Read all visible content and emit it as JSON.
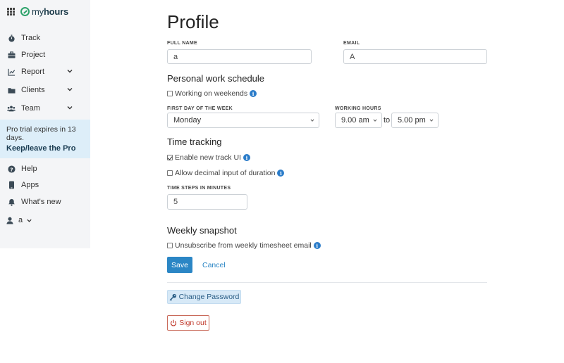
{
  "brand": {
    "name_prefix": "my",
    "name_suffix": "hours"
  },
  "sidebar": {
    "items": [
      {
        "label": "Track",
        "icon": "stopwatch-icon"
      },
      {
        "label": "Project",
        "icon": "briefcase-icon"
      },
      {
        "label": "Report",
        "icon": "chart-icon",
        "expandable": true
      },
      {
        "label": "Clients",
        "icon": "folder-icon",
        "expandable": true
      },
      {
        "label": "Team",
        "icon": "team-icon",
        "expandable": true
      }
    ],
    "trial_text": "Pro trial expires in 13 days.",
    "trial_link": "Keep/leave the Pro",
    "bottom_items": [
      {
        "label": "Help",
        "icon": "help-icon"
      },
      {
        "label": "Apps",
        "icon": "phone-icon"
      },
      {
        "label": "What's new",
        "icon": "bell-icon"
      }
    ],
    "user_label": "a"
  },
  "profile": {
    "title": "Profile",
    "full_name_label": "FULL NAME",
    "full_name_value": "a",
    "email_label": "EMAIL",
    "email_value": "A",
    "schedule_title": "Personal work schedule",
    "weekends_label": "Working on weekends",
    "weekends_checked": false,
    "first_day_label": "FIRST DAY OF THE WEEK",
    "first_day_value": "Monday",
    "working_hours_label": "WORKING HOURS",
    "hours_from": "9.00 am",
    "hours_to_word": "to",
    "hours_to": "5.00 pm",
    "time_tracking_title": "Time tracking",
    "new_track_ui_label": "Enable new track UI",
    "new_track_ui_checked": true,
    "decimal_input_label": "Allow decimal input of duration",
    "decimal_input_checked": false,
    "time_steps_label": "TIME STEPS IN MINUTES",
    "time_steps_value": "5",
    "snapshot_title": "Weekly snapshot",
    "unsubscribe_label": "Unsubscribe from weekly timesheet email",
    "unsubscribe_checked": false,
    "save_label": "Save",
    "cancel_label": "Cancel",
    "change_password_label": "Change Password",
    "sign_out_label": "Sign out"
  },
  "colors": {
    "accent": "#2b86c5",
    "brand_green": "#2ea36b",
    "danger": "#c0392b",
    "sidebar_bg": "#f4f5f7",
    "trial_bg": "#ddeef9"
  }
}
